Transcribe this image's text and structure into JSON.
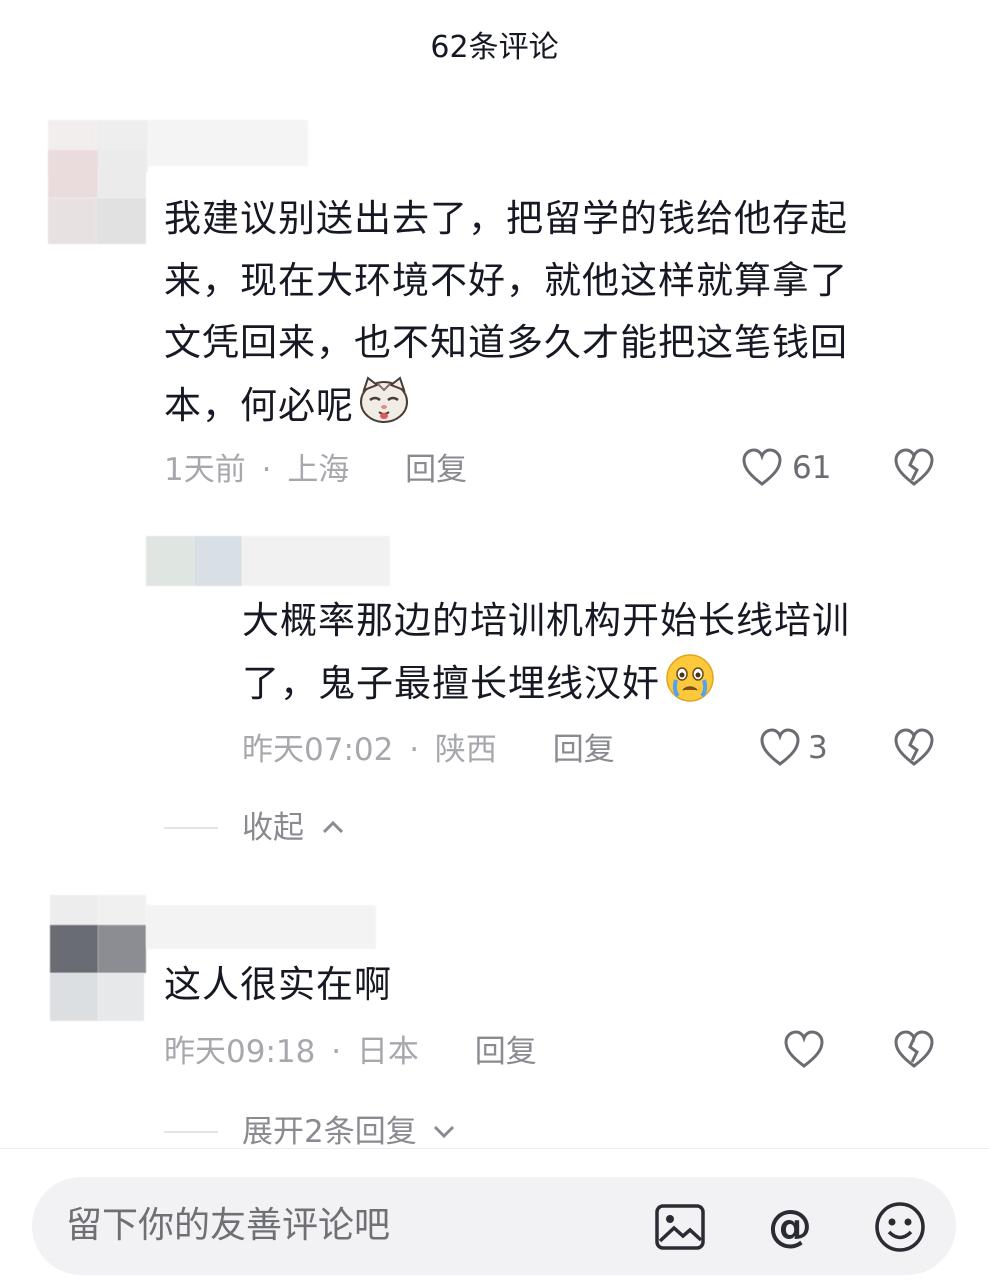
{
  "header": {
    "title": "62条评论"
  },
  "comments": [
    {
      "text": "我建议别送出去了，把留学的钱给他存起来，现在大环境不好，就他这样就算拿了文凭回来，也不知道多久才能把这笔钱回本，何必呢",
      "lines": [
        "我建议别送出去了，把留学的钱给他存起",
        "来，现在大环境不好，就他这样就算拿了",
        "文凭回来，也不知道多久才能把这笔钱回",
        "本，何必呢"
      ],
      "emoji": "cat-smirk-emoji",
      "time": "1天前",
      "location": "上海",
      "reply": "回复",
      "likes": "61"
    },
    {
      "lines": [
        "大概率那边的培训机构开始长线培训",
        "了，鬼子最擅长埋线汉奸"
      ],
      "emoji": "crying-emoji",
      "time": "昨天07:02",
      "location": "陕西",
      "reply": "回复",
      "likes": "3"
    },
    {
      "lines": [
        "这人很实在啊"
      ],
      "time": "昨天09:18",
      "location": "日本",
      "reply": "回复",
      "likes": ""
    }
  ],
  "collapse": {
    "label": "收起"
  },
  "expand": {
    "label": "展开2条回复"
  },
  "separator": "·",
  "input": {
    "placeholder": "留下你的友善评论吧"
  },
  "icons": [
    "heart-icon",
    "dislike-icon",
    "image-icon",
    "at-icon",
    "emoji-icon"
  ]
}
